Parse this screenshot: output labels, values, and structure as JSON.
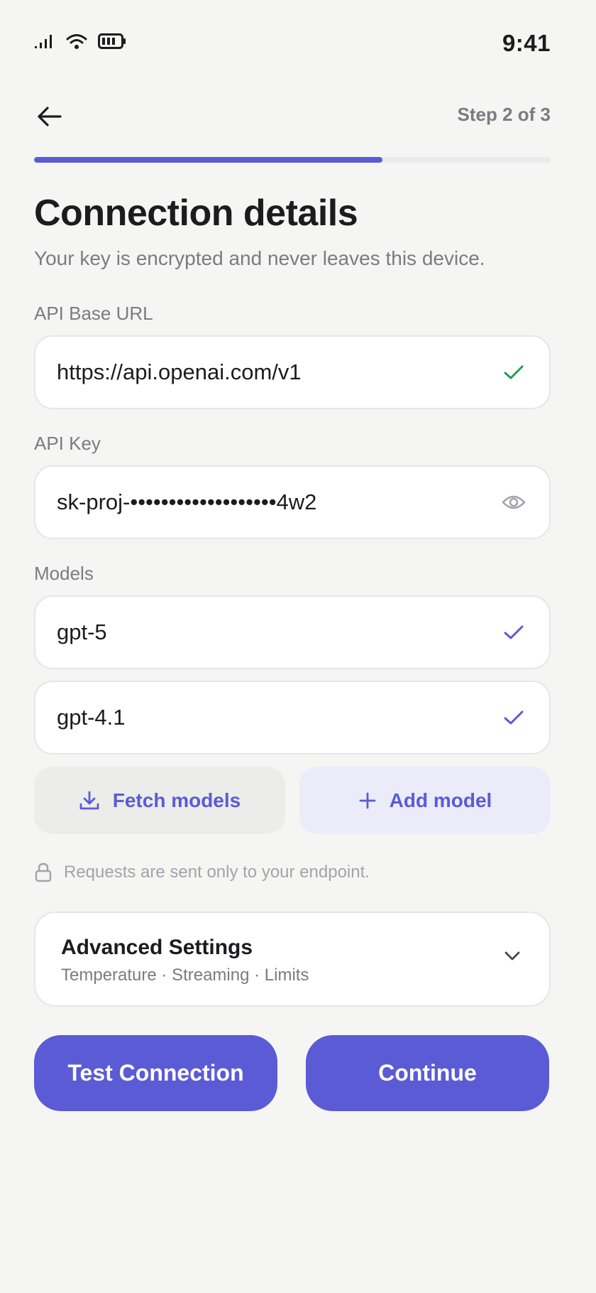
{
  "status_bar": {
    "time": "9:41",
    "icons": [
      "signal-icon",
      "wifi-icon",
      "battery-icon"
    ]
  },
  "header": {
    "back_icon": "arrow-left-icon",
    "step": "Step 2 of 3",
    "progress": 0.675
  },
  "page": {
    "title": "Connection details",
    "subtitle": "Your key is encrypted and never leaves this device."
  },
  "fields": {
    "base_url": {
      "label": "API Base URL",
      "value": "https://api.openai.com/v1",
      "status_icon": "check-icon",
      "status_color": "#1f9d55"
    },
    "api_key": {
      "label": "API Key",
      "value": "sk-proj-•••••••••••••••••••4w2",
      "toggle_icon": "eye-icon"
    }
  },
  "models": {
    "label": "Models",
    "items": [
      {
        "name": "gpt-5",
        "selected": true
      },
      {
        "name": "gpt-4.1",
        "selected": true
      }
    ]
  },
  "actions": {
    "fetch_label": "Fetch models",
    "fetch_icon": "download-icon",
    "add_label": "Add model",
    "add_icon": "plus-icon"
  },
  "privacy_note": {
    "icon": "lock-icon",
    "text": "Requests are sent only to your endpoint."
  },
  "advanced": {
    "title": "Advanced Settings",
    "subtitle": "Temperature · Streaming · Limits",
    "icon": "chevron-down-icon"
  },
  "footer": {
    "test_label": "Test Connection",
    "continue_label": "Continue"
  },
  "colors": {
    "accent": "#5b5bd6",
    "background": "#f5f5f3",
    "muted_text": "#7b7b82"
  }
}
